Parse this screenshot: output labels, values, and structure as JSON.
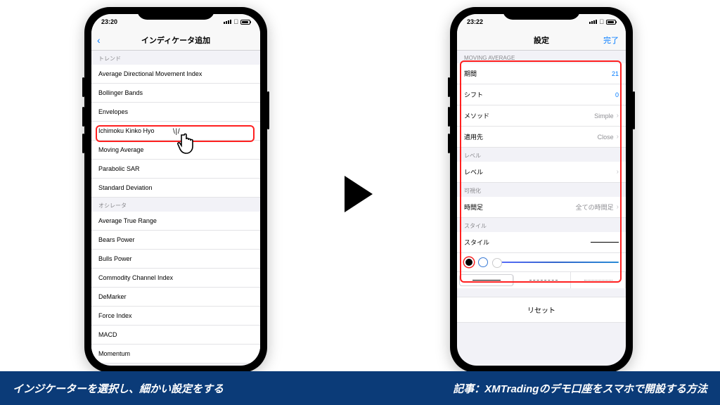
{
  "left_phone": {
    "time": "23:20",
    "nav_title": "インディケータ追加",
    "sections": [
      {
        "header": "トレンド",
        "items": [
          "Average Directional Movement Index",
          "Bollinger Bands",
          "Envelopes",
          "Ichimoku Kinko Hyo",
          "Moving Average",
          "Parabolic SAR",
          "Standard Deviation"
        ]
      },
      {
        "header": "オシレータ",
        "items": [
          "Average True Range",
          "Bears Power",
          "Bulls Power",
          "Commodity Channel Index",
          "DeMarker",
          "Force Index",
          "MACD",
          "Momentum"
        ]
      }
    ],
    "highlighted_item": "Moving Average"
  },
  "right_phone": {
    "time": "23:22",
    "nav_title": "設定",
    "nav_done": "完了",
    "section_header": "MOVING AVERAGE",
    "rows": {
      "period_label": "期間",
      "period_value": "21",
      "shift_label": "シフト",
      "shift_value": "0",
      "method_label": "メソッド",
      "method_value": "Simple",
      "apply_label": "適用先",
      "apply_value": "Close",
      "levels_header": "レベル",
      "levels_label": "レベル",
      "viz_header": "可視化",
      "timeframe_label": "時間足",
      "timeframe_value": "全ての時間足",
      "style_header": "スタイル",
      "style_label": "スタイル"
    },
    "reset_label": "リセット"
  },
  "footer": {
    "left_text": "インジケーターを選択し、細かい設定をする",
    "right_text": "記事：XMTradingのデモ口座をスマホで開設する方法"
  }
}
